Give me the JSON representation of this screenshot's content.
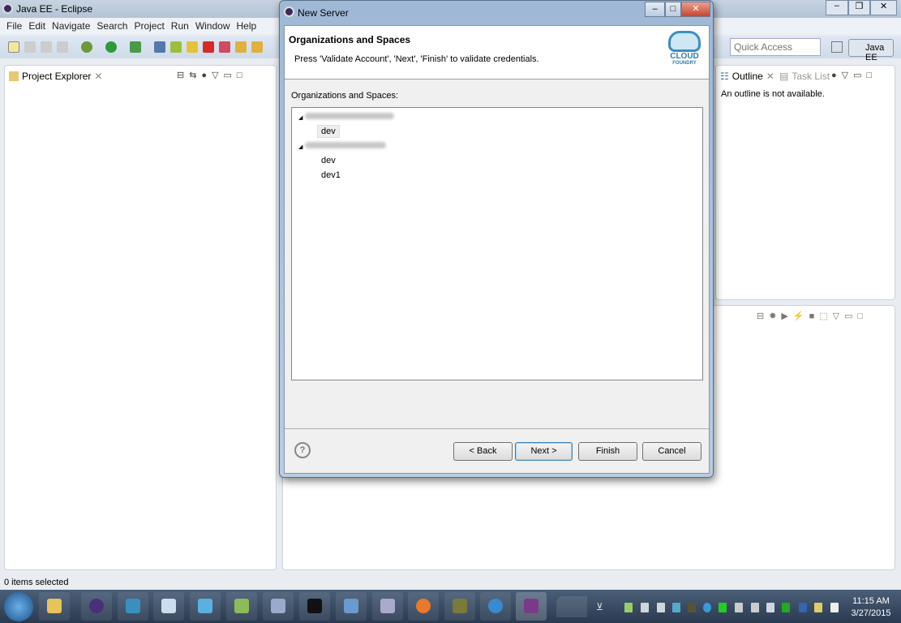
{
  "window": {
    "title": "Java EE - Eclipse"
  },
  "menu": [
    "File",
    "Edit",
    "Navigate",
    "Search",
    "Project",
    "Run",
    "Window",
    "Help"
  ],
  "quick_access": {
    "placeholder": "Quick Access"
  },
  "perspective": {
    "label": "Java EE"
  },
  "project_explorer": {
    "tab": "Project Explorer"
  },
  "outline": {
    "tab": "Outline",
    "tab2": "Task List",
    "message": "An outline is not available."
  },
  "status_bar": {
    "text": "0 items selected"
  },
  "dialog": {
    "title": "New Server",
    "header_title": "Organizations and Spaces",
    "header_desc": "Press 'Validate Account', 'Next', 'Finish' to validate credentials.",
    "logo": {
      "line1": "CLOUD",
      "line2": "FOUNDRY"
    },
    "tree_label": "Organizations and Spaces:",
    "orgs": [
      {
        "spaces": [
          "dev"
        ]
      },
      {
        "spaces": [
          "dev",
          "dev1"
        ]
      }
    ],
    "buttons": {
      "back": "< Back",
      "next": "Next >",
      "finish": "Finish",
      "cancel": "Cancel"
    }
  },
  "taskbar": {
    "time": "11:15 AM",
    "date": "3/27/2015"
  }
}
